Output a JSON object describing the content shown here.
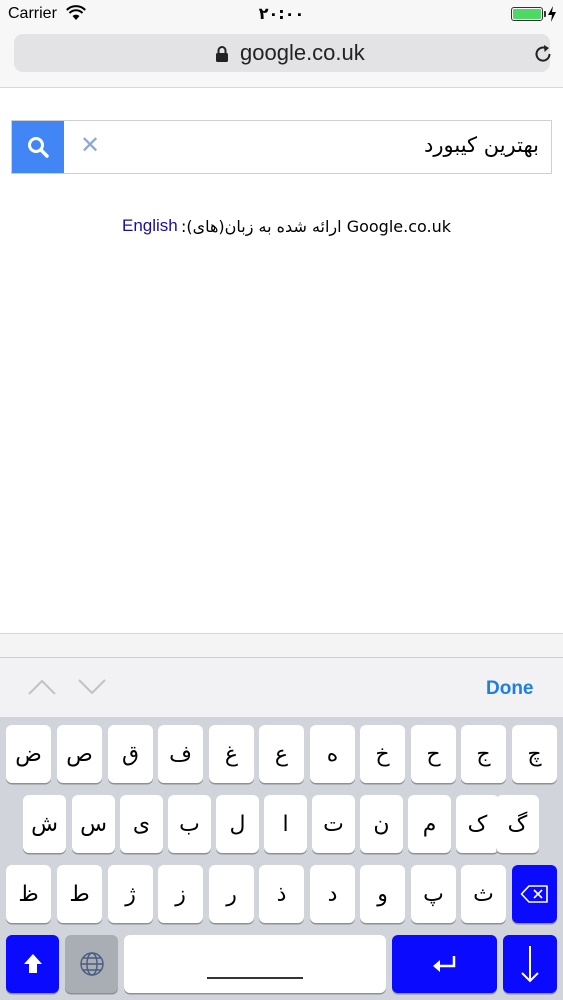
{
  "status_bar": {
    "carrier": "Carrier",
    "time": "۲۰:۰۰",
    "battery_color": "#4cd964"
  },
  "browser": {
    "url": "google.co.uk",
    "lock_icon": "lock-icon",
    "reload_icon": "reload-icon"
  },
  "search": {
    "query": "بهترین کیبورد",
    "button_color": "#4285f4",
    "search_icon": "search-icon",
    "clear_icon": "close-icon"
  },
  "language": {
    "offered_text": "Google.co.uk ارائه شده به زبان(های):",
    "english_link": "English"
  },
  "accessory_bar": {
    "done_label": "Done",
    "done_color": "#1d7fe0"
  },
  "keyboard": {
    "row1": [
      "ض",
      "ص",
      "ق",
      "ف",
      "غ",
      "ع",
      "ه",
      "خ",
      "ح",
      "ج",
      "چ"
    ],
    "row2": [
      "ش",
      "س",
      "ی",
      "ب",
      "ل",
      "ا",
      "ت",
      "ن",
      "م",
      "ک",
      "گ"
    ],
    "row3": [
      "ظ",
      "ط",
      "ژ",
      "ز",
      "ر",
      "ذ",
      "د",
      "و",
      "پ",
      "ث"
    ],
    "accent_color": "#0a0aff"
  }
}
